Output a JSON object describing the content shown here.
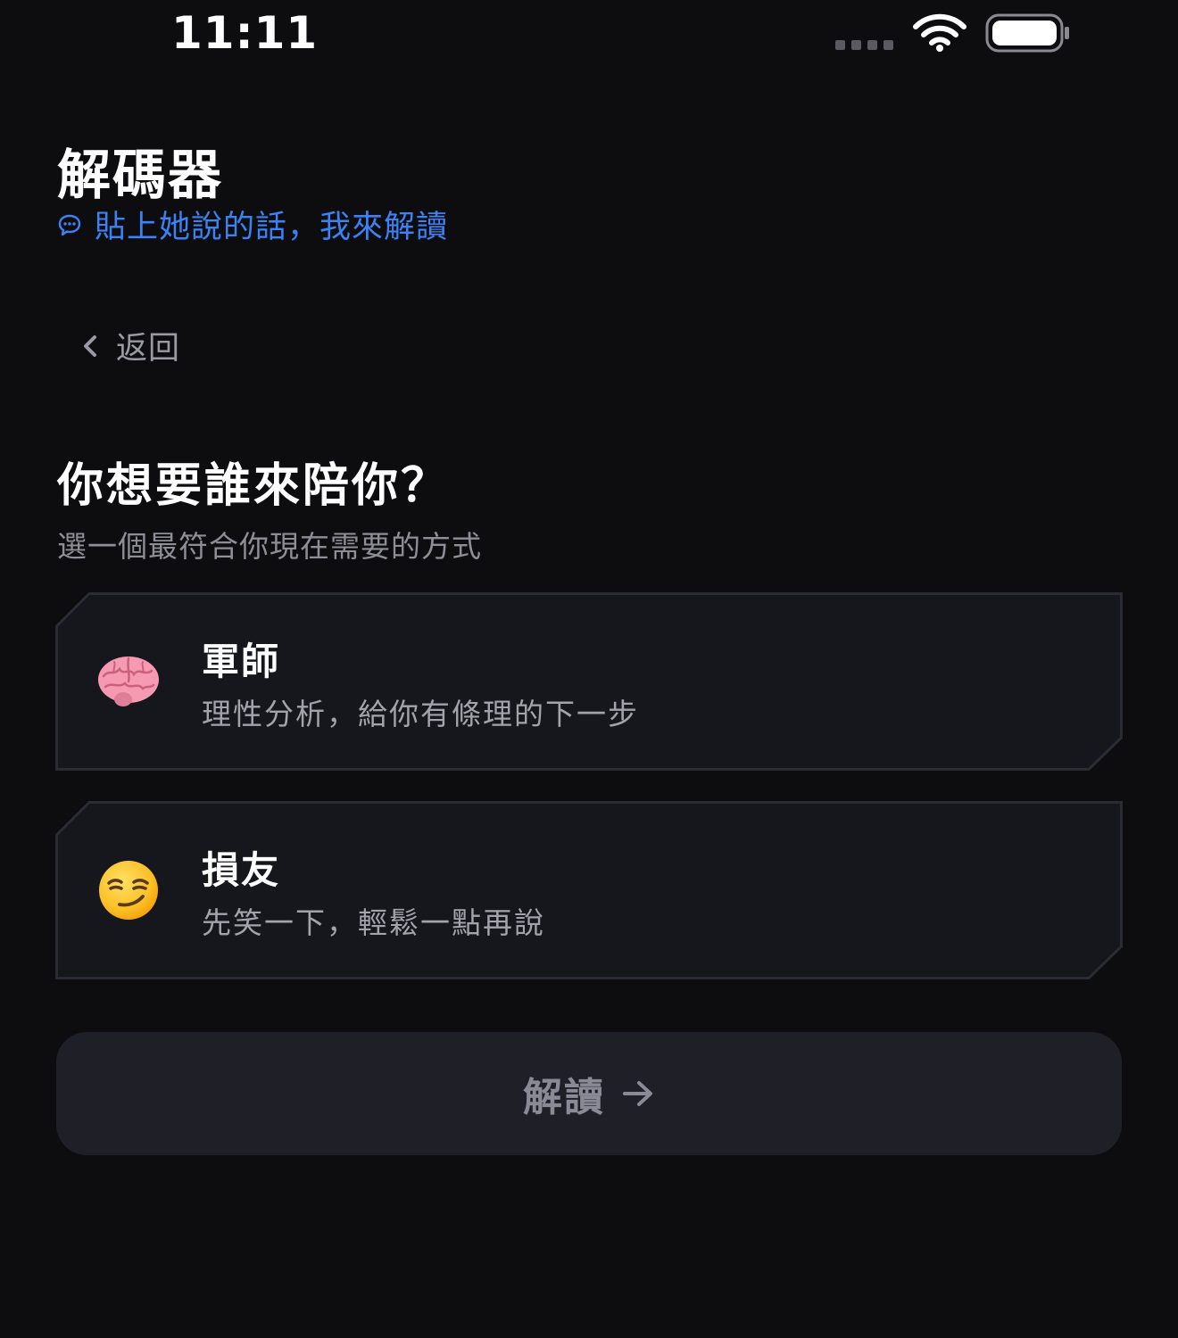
{
  "status_bar": {
    "time": "11:11"
  },
  "header": {
    "title": "解碼器",
    "subtitle": "貼上她說的話，我來解讀"
  },
  "nav": {
    "back_label": "返回"
  },
  "prompt": {
    "question": "你想要誰來陪你？",
    "hint": "選一個最符合你現在需要的方式"
  },
  "options": [
    {
      "icon": "brain-emoji",
      "title": "軍師",
      "description": "理性分析，給你有條理的下一步"
    },
    {
      "icon": "smirk-emoji",
      "title": "損友",
      "description": "先笑一下，輕鬆一點再說"
    }
  ],
  "actions": {
    "decode_label": "解讀"
  },
  "colors": {
    "background": "#0d0d10",
    "accent": "#3b82f6",
    "card": "#16171d",
    "card_border": "#2a2b33",
    "button": "#1e1f27"
  }
}
